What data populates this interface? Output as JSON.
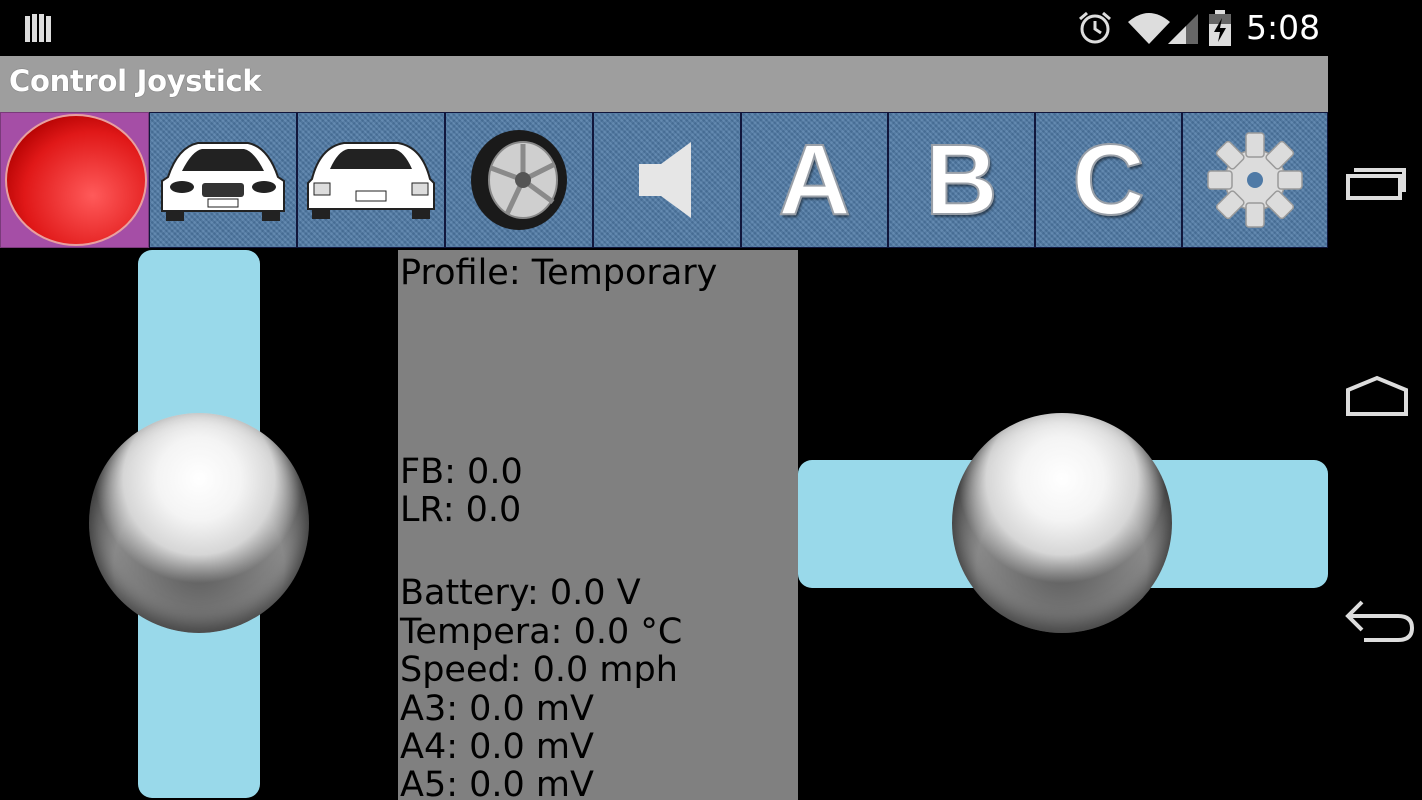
{
  "status_bar": {
    "time": "5:08",
    "icons": [
      "notification-bars-icon",
      "alarm-icon",
      "wifi-icon",
      "signal-icon",
      "battery-charging-icon"
    ]
  },
  "action_bar": {
    "title": "Control Joystick"
  },
  "toolbar": {
    "buttons": [
      {
        "name": "stop-button",
        "icon": "red-circle-icon"
      },
      {
        "name": "car-front-button",
        "icon": "car-front-icon"
      },
      {
        "name": "car-rear-button",
        "icon": "car-rear-icon"
      },
      {
        "name": "wheel-button",
        "icon": "wheel-icon"
      },
      {
        "name": "speaker-button",
        "icon": "speaker-icon"
      },
      {
        "name": "a-button",
        "label": "A"
      },
      {
        "name": "b-button",
        "label": "B"
      },
      {
        "name": "c-button",
        "label": "C"
      },
      {
        "name": "settings-button",
        "icon": "gear-icon"
      }
    ]
  },
  "info": {
    "profile": "Profile: Temporary",
    "fb": "FB: 0.0",
    "lr": "LR: 0.0",
    "battery": "Battery: 0.0 V",
    "temperature": "Tempera: 0.0 °C",
    "speed": "Speed: 0.0 mph",
    "a3": "A3: 0.0 mV",
    "a4": "A4: 0.0 mV",
    "a5": "A5: 0.0 mV"
  },
  "nav_bar": {
    "icons": [
      "recent-apps-icon",
      "home-icon",
      "back-icon"
    ]
  },
  "colors": {
    "track": "#99d9ea",
    "toolbar_tile": "#4f7aa6",
    "stop_tile": "#a54ea6",
    "info_panel": "#808080",
    "action_bar": "#9e9e9e"
  }
}
